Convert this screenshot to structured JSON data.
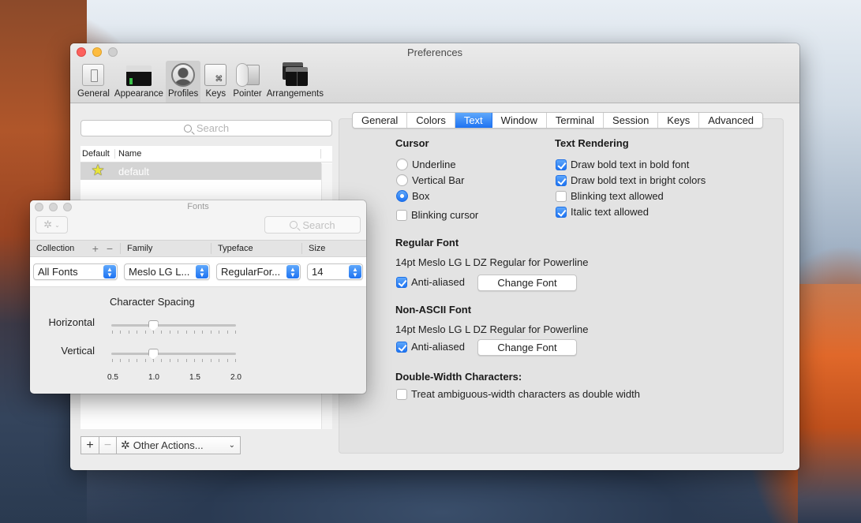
{
  "window": {
    "title": "Preferences",
    "toolbar": [
      {
        "label": "General",
        "icon": "general-switch-icon",
        "active": false
      },
      {
        "label": "Appearance",
        "icon": "appearance-terminal-icon",
        "active": false
      },
      {
        "label": "Profiles",
        "icon": "profiles-user-icon",
        "active": true
      },
      {
        "label": "Keys",
        "icon": "keys-command-icon",
        "active": false
      },
      {
        "label": "Pointer",
        "icon": "pointer-mouse-icon",
        "active": false
      },
      {
        "label": "Arrangements",
        "icon": "arrangements-windows-icon",
        "active": false
      }
    ],
    "keys_glyph": "⌘"
  },
  "profiles": {
    "search_placeholder": "Search",
    "columns": {
      "default": "Default",
      "name": "Name"
    },
    "rows": [
      {
        "default": true,
        "star": "★",
        "name": "default",
        "selected": true
      }
    ],
    "add_label": "+",
    "remove_label": "−",
    "other_actions_label": "Other Actions...",
    "gear_glyph": "✲",
    "chevron_glyph": "⌄"
  },
  "tabs": [
    {
      "label": "General",
      "active": false
    },
    {
      "label": "Colors",
      "active": false
    },
    {
      "label": "Text",
      "active": true
    },
    {
      "label": "Window",
      "active": false
    },
    {
      "label": "Terminal",
      "active": false
    },
    {
      "label": "Session",
      "active": false
    },
    {
      "label": "Keys",
      "active": false
    },
    {
      "label": "Advanced",
      "active": false
    }
  ],
  "text_tab": {
    "cursor": {
      "title": "Cursor",
      "options": [
        {
          "label": "Underline",
          "selected": false
        },
        {
          "label": "Vertical Bar",
          "selected": false
        },
        {
          "label": "Box",
          "selected": true
        }
      ],
      "blinking_cursor": {
        "label": "Blinking cursor",
        "checked": false
      }
    },
    "text_rendering": {
      "title": "Text Rendering",
      "options": [
        {
          "label": "Draw bold text in bold font",
          "checked": true
        },
        {
          "label": "Draw bold text in bright colors",
          "checked": true
        },
        {
          "label": "Blinking text allowed",
          "checked": false
        },
        {
          "label": "Italic text allowed",
          "checked": true
        }
      ]
    },
    "regular_font": {
      "title": "Regular Font",
      "description": "14pt Meslo LG L DZ Regular for Powerline",
      "anti_aliased": {
        "label": "Anti-aliased",
        "checked": true
      },
      "change_button": "Change Font"
    },
    "non_ascii_font": {
      "title": "Non-ASCII Font",
      "description": "14pt Meslo LG L DZ Regular for Powerline",
      "anti_aliased": {
        "label": "Anti-aliased",
        "checked": true
      },
      "change_button": "Change Font"
    },
    "double_width": {
      "title": "Double-Width Characters:",
      "option": {
        "label": "Treat ambiguous-width characters as double width",
        "checked": false
      }
    }
  },
  "fonts_panel": {
    "title": "Fonts",
    "search_placeholder": "Search",
    "gear_glyph": "✲",
    "chevron_glyph": "⌄",
    "headers": {
      "collection": "Collection",
      "plus_minus": "+ −",
      "family": "Family",
      "typeface": "Typeface",
      "size": "Size"
    },
    "selects": {
      "collection": "All Fonts",
      "family": "Meslo LG L...",
      "typeface": "RegularFor...",
      "size": "14"
    },
    "character_spacing": {
      "title": "Character Spacing",
      "horizontal_label": "Horizontal",
      "vertical_label": "Vertical",
      "min": 0.5,
      "max": 2.0,
      "step": 0.1,
      "horizontal_value": 1.0,
      "vertical_value": 1.0,
      "scale_labels": [
        "0.5",
        "1.0",
        "1.5",
        "2.0"
      ]
    }
  }
}
